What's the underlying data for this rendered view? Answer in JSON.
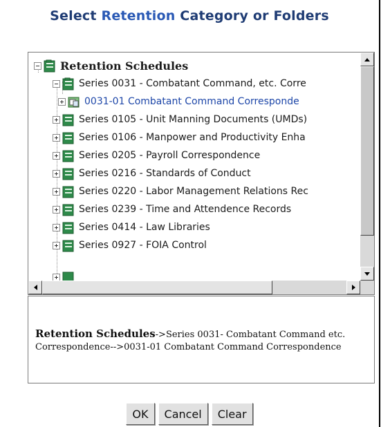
{
  "dialog": {
    "title_prefix": "Select ",
    "title_accent": "Retention",
    "title_suffix": " Category or Folders"
  },
  "tree": {
    "root": {
      "label": "Retention Schedules",
      "expanded": true
    },
    "series_0031": {
      "label": "Series 0031 - Combatant Command, etc. Corre",
      "expanded": true
    },
    "child_0031_01": {
      "label": "0031-01 Combatant Command Corresponde",
      "selected": true
    },
    "items": [
      {
        "label": "Series 0105 - Unit Manning Documents (UMDs)"
      },
      {
        "label": "Series 0106 - Manpower and Productivity Enha"
      },
      {
        "label": "Series 0205 - Payroll Correspondence"
      },
      {
        "label": "Series 0216 - Standards of Conduct"
      },
      {
        "label": "Series 0220 - Labor Management Relations Rec"
      },
      {
        "label": "Series 0239 - Time and Attendence Records"
      },
      {
        "label": "Series 0414 - Law Libraries"
      },
      {
        "label": "Series 0927 - FOIA Control"
      }
    ]
  },
  "selected_path": {
    "root": "Retention Schedules",
    "rest": "->Series 0031- Combatant Command etc. Correspondence-->0031-01 Combatant Command Correspondence"
  },
  "buttons": {
    "ok": "OK",
    "cancel": "Cancel",
    "clear": "Clear"
  },
  "colors": {
    "title": "#1f3c74",
    "title_accent": "#2a59b5",
    "selected_text": "#1d46a8",
    "folder_icon": "#2e8a4a"
  },
  "icons": {
    "expander_minus": "minus-box-icon",
    "expander_plus": "plus-box-icon",
    "series_folder": "green-folder-icon",
    "open_folder": "open-folder-icon"
  }
}
